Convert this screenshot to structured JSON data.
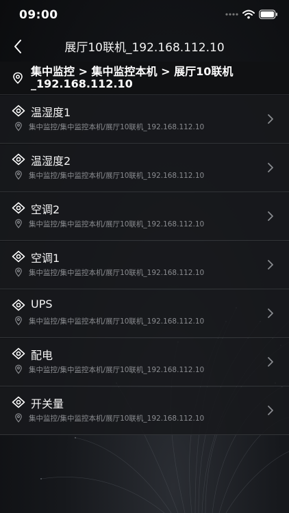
{
  "status_bar": {
    "time": "09:00"
  },
  "nav": {
    "title": "展厅10联机_192.168.112.10"
  },
  "breadcrumb": {
    "line1": "集中监控 > 集中监控本机 > 展厅10联机",
    "line2": "_192.168.112.10"
  },
  "items": [
    {
      "name": "温湿度1",
      "path": "集中监控/集中监控本机/展厅10联机_192.168.112.10"
    },
    {
      "name": "温湿度2",
      "path": "集中监控/集中监控本机/展厅10联机_192.168.112.10"
    },
    {
      "name": "空调2",
      "path": "集中监控/集中监控本机/展厅10联机_192.168.112.10"
    },
    {
      "name": "空调1",
      "path": "集中监控/集中监控本机/展厅10联机_192.168.112.10"
    },
    {
      "name": "UPS",
      "path": "集中监控/集中监控本机/展厅10联机_192.168.112.10"
    },
    {
      "name": "配电",
      "path": "集中监控/集中监控本机/展厅10联机_192.168.112.10"
    },
    {
      "name": "开关量",
      "path": "集中监控/集中监控本机/展厅10联机_192.168.112.10"
    }
  ],
  "icons": {
    "back": "chevron-left-icon",
    "location": "location-pin-icon",
    "eye": "eye-icon",
    "chevron": "chevron-right-icon",
    "signal": "signal-icon",
    "wifi": "wifi-icon",
    "battery": "battery-icon"
  },
  "colors": {
    "background": "#0b0c0e",
    "row": "#18191c",
    "divider": "#333538",
    "secondary_text": "#8a8c90"
  }
}
